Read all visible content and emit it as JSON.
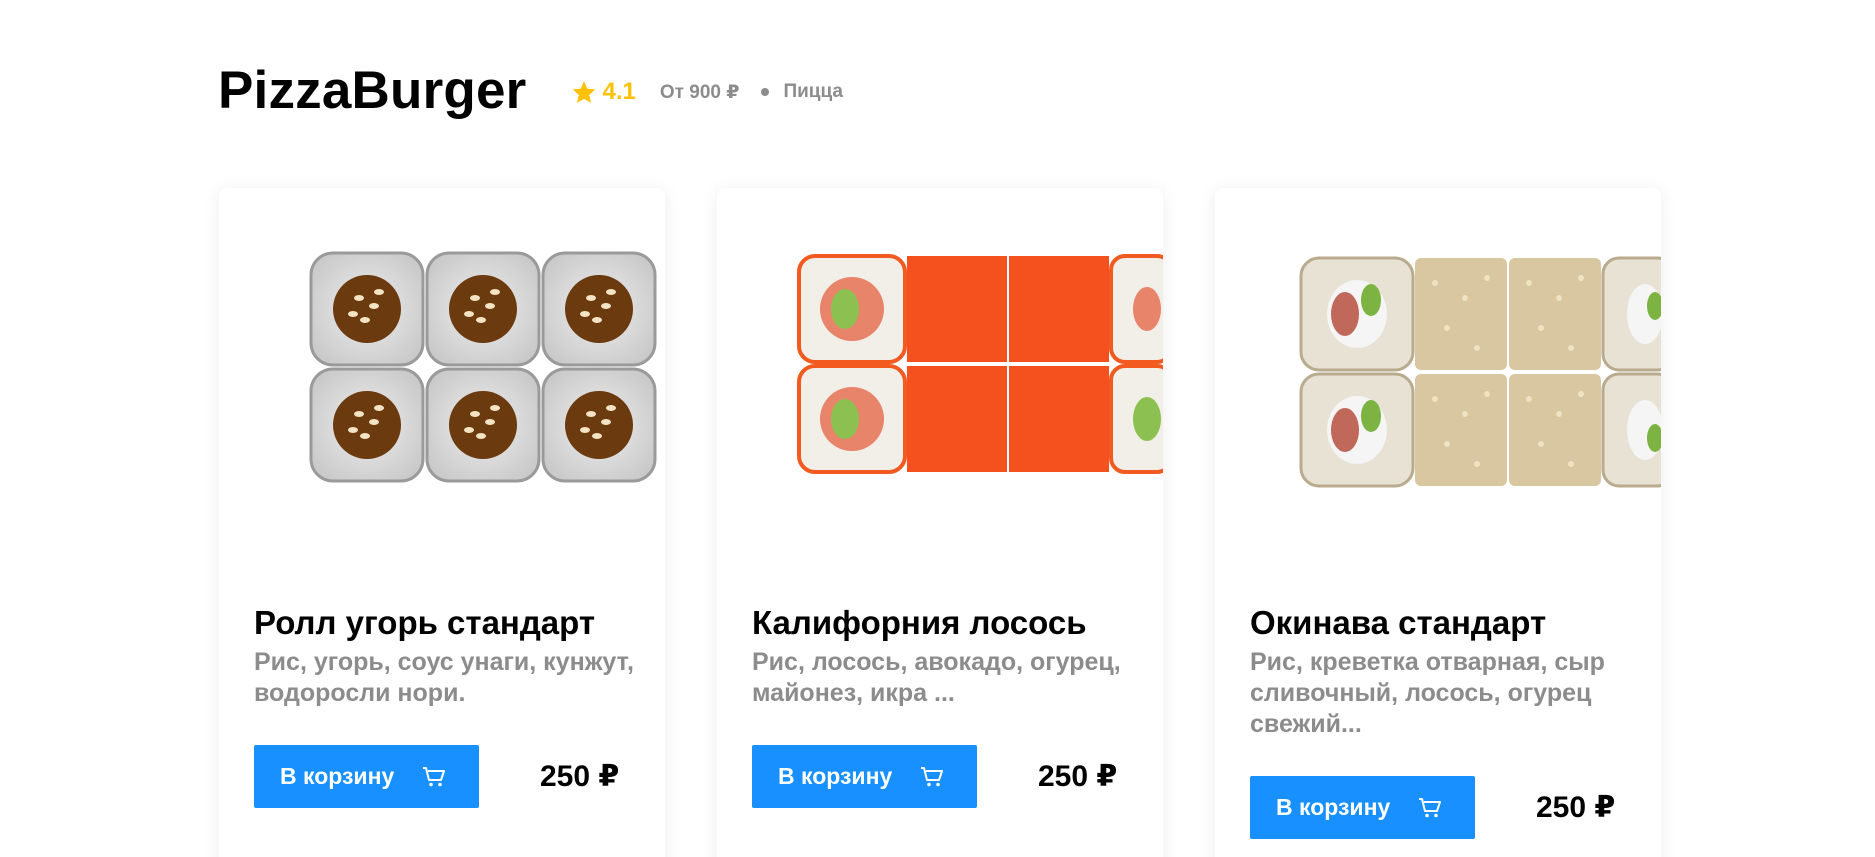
{
  "restaurant": {
    "name": "PizzaBurger",
    "rating": "4.1",
    "price_from": "От 900 ₽",
    "category": "Пицца"
  },
  "colors": {
    "accent": "#1890ff",
    "rating": "#ffc107",
    "muted": "#8c8c8c"
  },
  "cards": [
    {
      "title": "Ролл угорь стандарт",
      "description": "Рис, угорь, соус унаги, кунжут, водоросли нори.",
      "button_label": "В корзину",
      "price": "250 ₽",
      "image": "eel-roll-image"
    },
    {
      "title": "Калифорния лосось",
      "description": "Рис, лосось, авокадо, огурец, майонез, икра ...",
      "button_label": "В корзину",
      "price": "250 ₽",
      "image": "california-salmon-roll-image"
    },
    {
      "title": "Окинава стандарт",
      "description": "Рис, креветка отварная, сыр сливочный, лосось, огурец свежий...",
      "button_label": "В корзину",
      "price": "250 ₽",
      "image": "okinawa-roll-image"
    }
  ]
}
